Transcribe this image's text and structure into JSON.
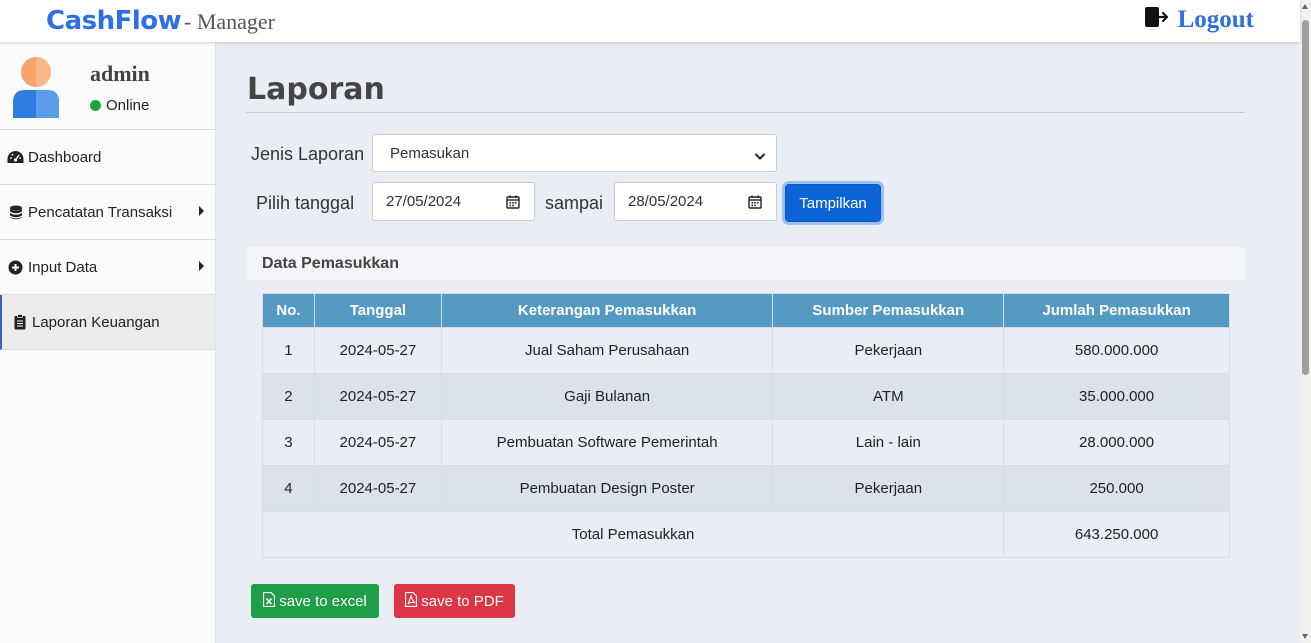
{
  "header": {
    "brand": "CashFlow",
    "brand_suffix": "- Manager",
    "logout_label": "Logout",
    "logout_icon": "logout-icon"
  },
  "sidebar": {
    "user": {
      "name": "admin",
      "status": "Online",
      "status_color": "#1fa53b"
    },
    "items": [
      {
        "label": "Dashboard",
        "icon": "dashboard-icon",
        "has_submenu": false
      },
      {
        "label": "Pencatatan Transaksi",
        "icon": "database-icon",
        "has_submenu": true
      },
      {
        "label": "Input Data",
        "icon": "plus-circle-icon",
        "has_submenu": true
      },
      {
        "label": "Laporan Keuangan",
        "icon": "clipboard-icon",
        "has_submenu": false,
        "active": true
      }
    ]
  },
  "main": {
    "title": "Laporan",
    "form": {
      "report_type_label": "Jenis Laporan",
      "report_type_value": "Pemasukan",
      "date_label": "Pilih tanggal",
      "date_from": "27/05/2024",
      "range_label": "sampai",
      "date_to": "28/05/2024",
      "submit_label": "Tampilkan"
    },
    "card_title": "Data Pemasukkan",
    "table": {
      "headers": [
        "No.",
        "Tanggal",
        "Keterangan Pemasukkan",
        "Sumber Pemasukkan",
        "Jumlah Pemasukkan"
      ],
      "rows": [
        [
          "1",
          "2024-05-27",
          "Jual Saham Perusahaan",
          "Pekerjaan",
          "580.000.000"
        ],
        [
          "2",
          "2024-05-27",
          "Gaji Bulanan",
          "ATM",
          "35.000.000"
        ],
        [
          "3",
          "2024-05-27",
          "Pembuatan Software Pemerintah",
          "Lain - lain",
          "28.000.000"
        ],
        [
          "4",
          "2024-05-27",
          "Pembuatan Design Poster",
          "Pekerjaan",
          "250.000"
        ]
      ],
      "total_label": "Total Pemasukkan",
      "total_value": "643.250.000"
    },
    "actions": {
      "excel_label": "save to excel",
      "pdf_label": "save to PDF"
    }
  },
  "colors": {
    "brand": "#2f6fe4",
    "table_header": "#5499c1",
    "primary_button": "#0b63d6",
    "excel_button": "#1e9e47",
    "pdf_button": "#dc3545"
  }
}
